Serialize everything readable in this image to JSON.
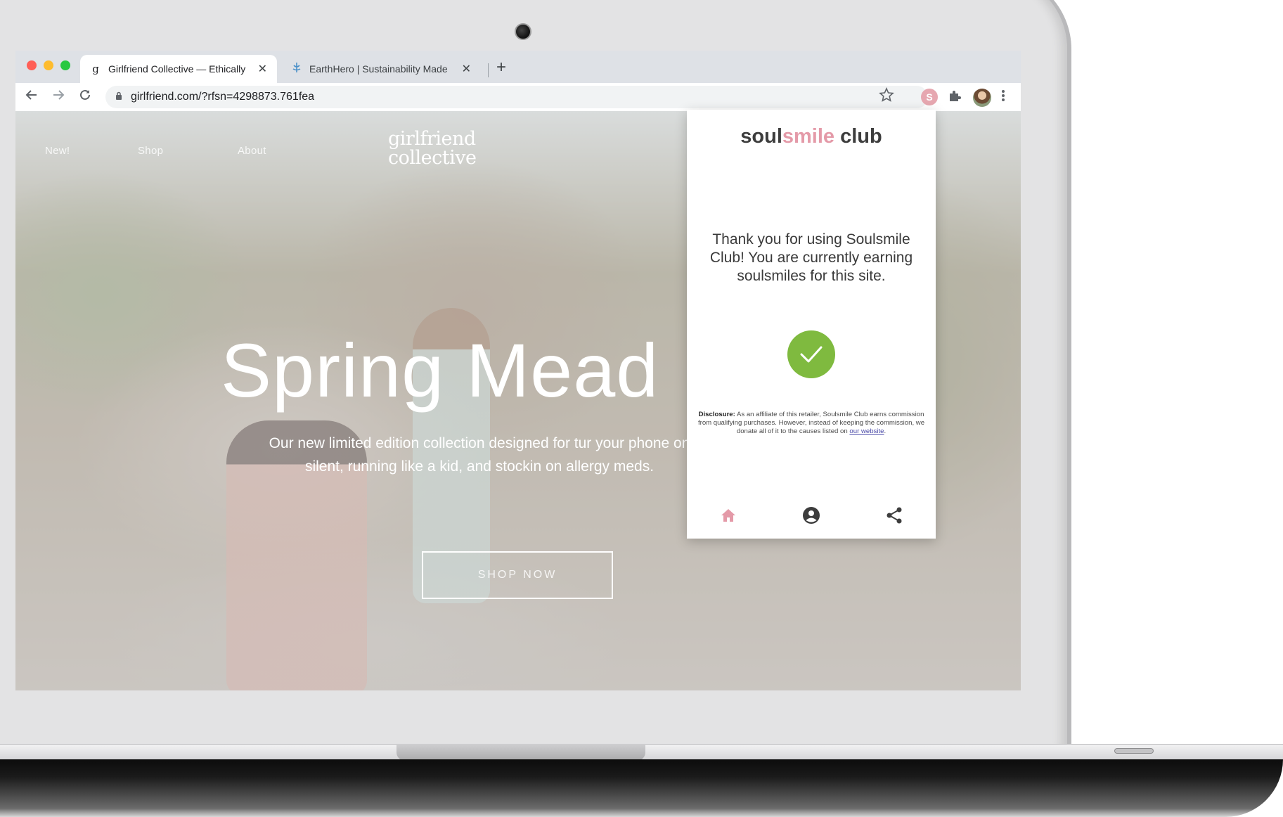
{
  "browser": {
    "tabs": [
      {
        "title": "Girlfriend Collective — Ethically",
        "favicon": "g",
        "active": true
      },
      {
        "title": "EarthHero | Sustainability Made",
        "favicon": "earthhero-icon",
        "active": false
      }
    ],
    "close_glyph": "✕",
    "new_tab_glyph": "+",
    "url": "girlfriend.com/?rfsn=4298873.761fea",
    "extension_badge": "S"
  },
  "site": {
    "nav": [
      "New!",
      "Shop",
      "About"
    ],
    "logo_line1": "girlfriend",
    "logo_line2": "collective",
    "hero_title": "Spring Mead",
    "hero_subtitle": "Our new limited edition collection designed for tur your phone on silent, running like a kid, and stockin on allergy meds.",
    "cta": "SHOP NOW"
  },
  "popup": {
    "brand_soul": "soul",
    "brand_smile": "smile",
    "brand_club": " club",
    "message": "Thank you for using Soulsmile Club! You are currently earning soulsmiles for this site.",
    "disclosure_label": "Disclosure:",
    "disclosure_text": " As an affiliate of this retailer, Soulsmile Club earns commission from qualifying purchases. However, instead of keeping the commission, we donate all of it to the causes listed on ",
    "disclosure_link": "our website",
    "disclosure_end": ".",
    "nav": [
      "home-icon",
      "account-icon",
      "share-icon"
    ]
  },
  "colors": {
    "brand_pink": "#e49aa8",
    "check_green": "#7fba3f",
    "home_icon": "#e49aa8",
    "icon_dark": "#3d3d3d"
  }
}
